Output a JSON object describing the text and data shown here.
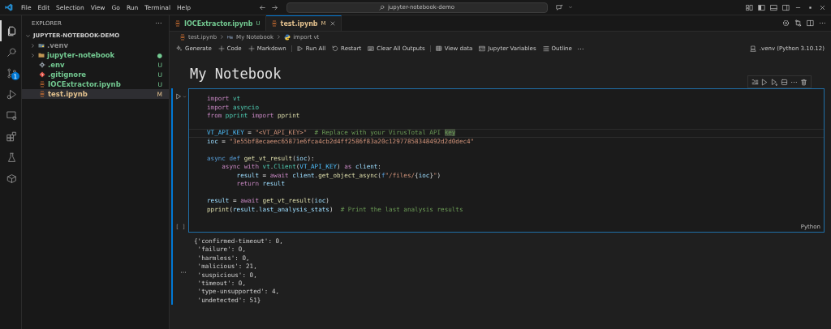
{
  "title_bar": {
    "menu": [
      "File",
      "Edit",
      "Selection",
      "View",
      "Go",
      "Run",
      "Terminal",
      "Help"
    ],
    "search": "jupyter-notebook-demo"
  },
  "activity_bar": [
    {
      "kind": "files",
      "selected": true
    },
    {
      "kind": "search",
      "selected": false
    },
    {
      "kind": "source-control",
      "selected": false,
      "badge": "1"
    },
    {
      "kind": "run-debug",
      "selected": false
    },
    {
      "kind": "remote",
      "selected": false
    },
    {
      "kind": "extensions",
      "selected": false
    },
    {
      "kind": "testing",
      "selected": false
    },
    {
      "kind": "package",
      "selected": false
    }
  ],
  "sidebar": {
    "title": "EXPLORER",
    "tree": {
      "label": "JUPYTER-NOTEBOOK-DEMO",
      "expanded": true,
      "children": [
        {
          "label": ".venv",
          "kind": "python-folder",
          "expanded": false,
          "color": "#8c8c8c",
          "selected": false
        },
        {
          "label": "jupyter-notebook",
          "kind": "folder",
          "expanded": false,
          "color": "#73c991",
          "badge": "●",
          "selected": false
        },
        {
          "label": ".env",
          "kind": "gear",
          "color": "#73c991",
          "badge": "U",
          "selected": false
        },
        {
          "label": ".gitignore",
          "kind": "git",
          "color": "#73c991",
          "badge": "U",
          "selected": false
        },
        {
          "label": "IOCExtractor.ipynb",
          "kind": "notebook",
          "color": "#73c991",
          "badge": "U",
          "selected": false
        },
        {
          "label": "test.ipynb",
          "kind": "notebook",
          "color": "#e2c08d",
          "badge": "M",
          "selected": true
        }
      ]
    }
  },
  "tabs": [
    {
      "label": "IOCExtractor.ipynb",
      "badge": "U",
      "color": "#73c991",
      "selected": false
    },
    {
      "label": "test.ipynb",
      "badge": "M",
      "color": "#e2c08d",
      "selected": true
    }
  ],
  "breadcrumb": [
    {
      "kind": "notebook",
      "text": "test.ipynb"
    },
    {
      "kind": "markdown",
      "text": "My Notebook"
    },
    {
      "kind": "python",
      "text": "import vt"
    }
  ],
  "toolbar": {
    "groups": [
      [
        {
          "kind": "sparkle",
          "label": "Generate"
        },
        {
          "kind": "plus",
          "label": "Code"
        },
        {
          "kind": "plus",
          "label": "Markdown"
        }
      ],
      [
        {
          "kind": "run-all",
          "label": "Run All"
        },
        {
          "kind": "restart",
          "label": "Restart"
        },
        {
          "kind": "clear",
          "label": "Clear All Outputs"
        }
      ],
      [
        {
          "kind": "table",
          "label": "View data"
        },
        {
          "kind": "variables",
          "label": "Jupyter Variables"
        },
        {
          "kind": "outline",
          "label": "Outline"
        }
      ]
    ],
    "kernel": ".venv (Python 3.10.12)"
  },
  "notebook": {
    "heading": "My Notebook",
    "cell": {
      "selected": true,
      "execution": "[ ]",
      "language": "Python",
      "lines": [
        {
          "tokens": [
            {
              "kind": "keyword",
              "text": "import "
            },
            {
              "kind": "module",
              "text": "vt"
            }
          ]
        },
        {
          "tokens": [
            {
              "kind": "keyword",
              "text": "import "
            },
            {
              "kind": "module",
              "text": "asyncio"
            }
          ]
        },
        {
          "tokens": [
            {
              "kind": "keyword",
              "text": "from "
            },
            {
              "kind": "module",
              "text": "pprint "
            },
            {
              "kind": "keyword",
              "text": "import "
            },
            {
              "kind": "function",
              "text": "pprint"
            }
          ]
        },
        {
          "blank_before": true,
          "current": true,
          "tokens": [
            {
              "kind": "constant",
              "text": "VT_API_KEY"
            },
            {
              "kind": "plain",
              "text": " = "
            },
            {
              "kind": "string",
              "text": "\"<VT_API_KEY>\""
            },
            {
              "kind": "comment",
              "text": "  # Replace with your VirusTotal API "
            },
            {
              "kind": "comment-selected",
              "text": "key"
            }
          ]
        },
        {
          "tokens": [
            {
              "kind": "variable",
              "text": "ioc"
            },
            {
              "kind": "plain",
              "text": " = "
            },
            {
              "kind": "string",
              "text": "\"3e55bf8ecaeec65871e6fca4cb2d4ff2586f83a20c12977858348492d2d0dec4\""
            }
          ]
        },
        {
          "blank_before": true,
          "tokens": [
            {
              "kind": "storage",
              "text": "async def "
            },
            {
              "kind": "function",
              "text": "get_vt_result"
            },
            {
              "kind": "plain",
              "text": "("
            },
            {
              "kind": "variable",
              "text": "ioc"
            },
            {
              "kind": "plain",
              "text": "):"
            }
          ]
        },
        {
          "tokens": [
            {
              "kind": "keyword",
              "text": "    async with "
            },
            {
              "kind": "module",
              "text": "vt"
            },
            {
              "kind": "plain",
              "text": "."
            },
            {
              "kind": "module",
              "text": "Client"
            },
            {
              "kind": "plain",
              "text": "("
            },
            {
              "kind": "constant",
              "text": "VT_API_KEY"
            },
            {
              "kind": "plain",
              "text": ") "
            },
            {
              "kind": "keyword",
              "text": "as "
            },
            {
              "kind": "variable",
              "text": "client"
            },
            {
              "kind": "plain",
              "text": ":"
            }
          ]
        },
        {
          "tokens": [
            {
              "kind": "variable",
              "text": "        result"
            },
            {
              "kind": "plain",
              "text": " = "
            },
            {
              "kind": "keyword",
              "text": "await "
            },
            {
              "kind": "variable",
              "text": "client"
            },
            {
              "kind": "plain",
              "text": "."
            },
            {
              "kind": "function",
              "text": "get_object_async"
            },
            {
              "kind": "plain",
              "text": "("
            },
            {
              "kind": "storage",
              "text": "f"
            },
            {
              "kind": "string",
              "text": "\"/files/"
            },
            {
              "kind": "plain",
              "text": "{"
            },
            {
              "kind": "variable",
              "text": "ioc"
            },
            {
              "kind": "plain",
              "text": "}"
            },
            {
              "kind": "string",
              "text": "\""
            },
            {
              "kind": "plain",
              "text": ")"
            }
          ]
        },
        {
          "tokens": [
            {
              "kind": "keyword",
              "text": "        return "
            },
            {
              "kind": "variable",
              "text": "result"
            }
          ]
        },
        {
          "blank_before": true,
          "tokens": [
            {
              "kind": "variable",
              "text": "result"
            },
            {
              "kind": "plain",
              "text": " = "
            },
            {
              "kind": "keyword",
              "text": "await "
            },
            {
              "kind": "function",
              "text": "get_vt_result"
            },
            {
              "kind": "plain",
              "text": "("
            },
            {
              "kind": "variable",
              "text": "ioc"
            },
            {
              "kind": "plain",
              "text": ")"
            }
          ]
        },
        {
          "tokens": [
            {
              "kind": "function",
              "text": "pprint"
            },
            {
              "kind": "plain",
              "text": "("
            },
            {
              "kind": "variable",
              "text": "result"
            },
            {
              "kind": "plain",
              "text": "."
            },
            {
              "kind": "variable",
              "text": "last_analysis_stats"
            },
            {
              "kind": "plain",
              "text": ")"
            },
            {
              "kind": "comment",
              "text": "  # Print the last analysis results"
            }
          ]
        }
      ]
    },
    "output": [
      "{'confirmed-timeout': 0,",
      " 'failure': 0,",
      " 'harmless': 0,",
      " 'malicious': 21,",
      " 'suspicious': 0,",
      " 'timeout': 0,",
      " 'type-unsupported': 4,",
      " 'undetected': 51}"
    ]
  }
}
